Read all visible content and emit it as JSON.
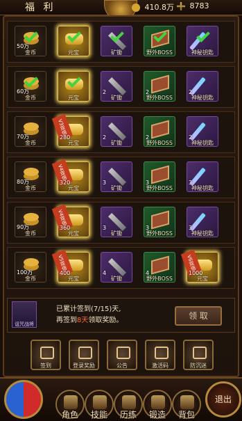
{
  "header": {
    "title": "福 利",
    "resource_gold": "410.8万",
    "resource_cross": "8783"
  },
  "rows": [
    {
      "cells": [
        {
          "type": "gold",
          "label": "金币",
          "count": "50万",
          "claimed": true
        },
        {
          "type": "yuanbao",
          "label": "元宝",
          "count": "",
          "claimed": true,
          "glow": true
        },
        {
          "type": "pick",
          "label": "矿锄",
          "count": "",
          "claimed": true
        },
        {
          "type": "boss",
          "label": "野外BOSS",
          "count": "",
          "claimed": true
        },
        {
          "type": "key",
          "label": "神秘钥匙",
          "count": "",
          "claimed": true
        }
      ]
    },
    {
      "cells": [
        {
          "type": "gold",
          "label": "金币",
          "count": "60万",
          "claimed": true
        },
        {
          "type": "yuanbao",
          "label": "元宝",
          "count": "",
          "claimed": true,
          "glow": true
        },
        {
          "type": "pick",
          "label": "矿锄",
          "count": "2"
        },
        {
          "type": "boss",
          "label": "野外BOSS",
          "count": "2"
        },
        {
          "type": "key",
          "label": "神秘钥匙",
          "count": "2"
        }
      ]
    },
    {
      "cells": [
        {
          "type": "gold",
          "label": "金币",
          "count": "70万"
        },
        {
          "type": "yuanbao",
          "label": "元宝",
          "count": "280",
          "ribbon": "V3双倍",
          "glow": true
        },
        {
          "type": "pick",
          "label": "矿锄",
          "count": "2"
        },
        {
          "type": "boss",
          "label": "野外BOSS",
          "count": "2"
        },
        {
          "type": "key",
          "label": "神秘钥匙",
          "count": "2"
        }
      ]
    },
    {
      "cells": [
        {
          "type": "gold",
          "label": "金币",
          "count": "80万"
        },
        {
          "type": "yuanbao",
          "label": "元宝",
          "count": "320",
          "ribbon": "V4双倍",
          "glow": true
        },
        {
          "type": "pick",
          "label": "矿锄",
          "count": "3"
        },
        {
          "type": "boss",
          "label": "野外BOSS",
          "count": "3"
        },
        {
          "type": "key",
          "label": "神秘钥匙",
          "count": "3"
        }
      ]
    },
    {
      "cells": [
        {
          "type": "gold",
          "label": "金币",
          "count": "90万"
        },
        {
          "type": "yuanbao",
          "label": "元宝",
          "count": "360",
          "ribbon": "V4双倍",
          "glow": true
        },
        {
          "type": "pick",
          "label": "矿锄",
          "count": "3"
        },
        {
          "type": "boss",
          "label": "野外BOSS",
          "count": "3"
        },
        {
          "type": "key",
          "label": "神秘钥匙",
          "count": "3"
        }
      ]
    },
    {
      "cells": [
        {
          "type": "gold",
          "label": "金币",
          "count": "100万"
        },
        {
          "type": "yuanbao",
          "label": "元宝",
          "count": "400",
          "ribbon": "V5双倍",
          "glow": true
        },
        {
          "type": "pick",
          "label": "矿锄",
          "count": "4"
        },
        {
          "type": "boss",
          "label": "野外BOSS",
          "count": "4"
        },
        {
          "type": "yuanbao",
          "label": "元宝",
          "count": "1000",
          "ribbon": "V6双倍",
          "glow": true
        }
      ]
    }
  ],
  "info": {
    "boss_name": "诅咒战将",
    "line1": "已累计签到(7/15)天,",
    "line2_prefix": "再签到",
    "line2_highlight": "8天",
    "line2_suffix": "领取奖励。",
    "claim_button": "领 取"
  },
  "tabs": [
    "签到",
    "登录奖励",
    "公告",
    "激活码",
    "防沉迷"
  ],
  "bottom_nav": {
    "items": [
      "角色",
      "技能",
      "历练",
      "锻造",
      "背包"
    ],
    "back": "退出"
  }
}
